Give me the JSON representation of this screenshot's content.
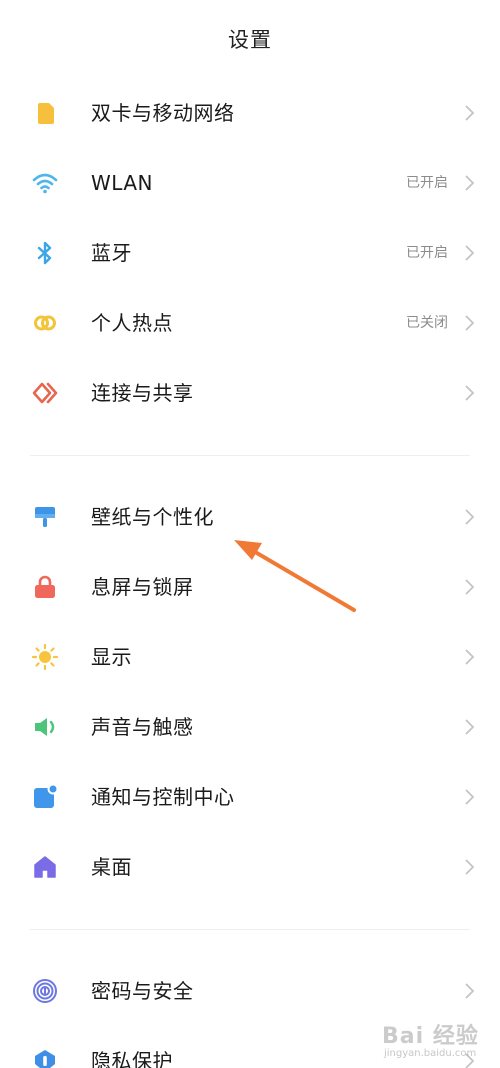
{
  "header": {
    "title": "设置"
  },
  "group1": [
    {
      "label": "双卡与移动网络",
      "status": "",
      "icon": "sim-card-icon",
      "color": "#F6C03C"
    },
    {
      "label": "WLAN",
      "status": "已开启",
      "icon": "wifi-icon",
      "color": "#4DB7EB"
    },
    {
      "label": "蓝牙",
      "status": "已开启",
      "icon": "bluetooth-icon",
      "color": "#3EA5E6"
    },
    {
      "label": "个人热点",
      "status": "已关闭",
      "icon": "hotspot-icon",
      "color": "#F2C43A"
    },
    {
      "label": "连接与共享",
      "status": "",
      "icon": "connection-share-icon",
      "color": "#E8664F"
    }
  ],
  "group2": [
    {
      "label": "壁纸与个性化",
      "status": "",
      "icon": "wallpaper-brush-icon",
      "color": "#3D95E8"
    },
    {
      "label": "息屏与锁屏",
      "status": "",
      "icon": "lock-icon",
      "color": "#F0685C"
    },
    {
      "label": "显示",
      "status": "",
      "icon": "sun-icon",
      "color": "#F7C53D"
    },
    {
      "label": "声音与触感",
      "status": "",
      "icon": "speaker-icon",
      "color": "#4CC57A"
    },
    {
      "label": "通知与控制中心",
      "status": "",
      "icon": "notification-icon",
      "color": "#3F96EA"
    },
    {
      "label": "桌面",
      "status": "",
      "icon": "home-icon",
      "color": "#7A6BE6"
    }
  ],
  "group3": [
    {
      "label": "密码与安全",
      "status": "",
      "icon": "fingerprint-icon",
      "color": "#6C78E0"
    },
    {
      "label": "隐私保护",
      "status": "",
      "icon": "privacy-shield-icon",
      "color": "#3F8FE6"
    }
  ],
  "annotation": {
    "color": "#F07A35",
    "points_to": "壁纸与个性化"
  },
  "watermark": {
    "text": "Bai 经验",
    "sub": "jingyan.baidu.com"
  }
}
